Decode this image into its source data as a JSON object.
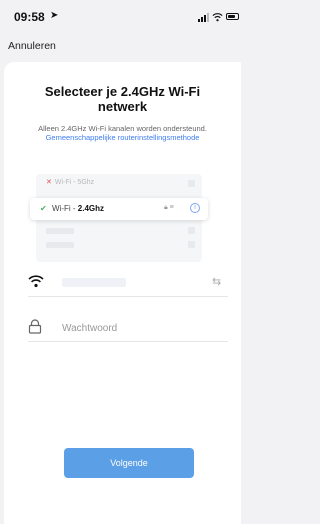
{
  "status_bar": {
    "time": "09:58",
    "location_icon": "location-arrow-icon",
    "signal_icon": "cellular-signal-icon",
    "wifi_icon": "wifi-icon",
    "battery_icon": "battery-icon"
  },
  "nav": {
    "cancel_label": "Annuleren"
  },
  "page": {
    "title": "Selecteer je 2.4GHz Wi-Fi netwerk",
    "subtitle_text": "Alleen 2.4GHz Wi-Fi kanalen worden ondersteund.",
    "subtitle_link": "Gemeenschappelijke routerinstellingsmethode"
  },
  "illustration": {
    "row_5g_prefix": "Wi-Fi - ",
    "row_5g_band": "5Ghz",
    "row_24_prefix": "Wi-Fi - ",
    "row_24_band": "2.4Ghz",
    "x_icon": "cross-icon",
    "check_icon": "check-icon",
    "lock_icon": "lock-icon",
    "info_icon": "info-icon"
  },
  "form": {
    "ssid_icon": "wifi-icon",
    "swap_icon": "swap-arrows-icon",
    "password_icon": "lock-icon",
    "password_placeholder": "Wachtwoord"
  },
  "actions": {
    "next_label": "Volgende"
  },
  "colors": {
    "accent": "#5b9fe6",
    "link": "#3f7ef0",
    "check": "#49b36a",
    "cross": "#e05050",
    "background": "#f2f2f4"
  }
}
